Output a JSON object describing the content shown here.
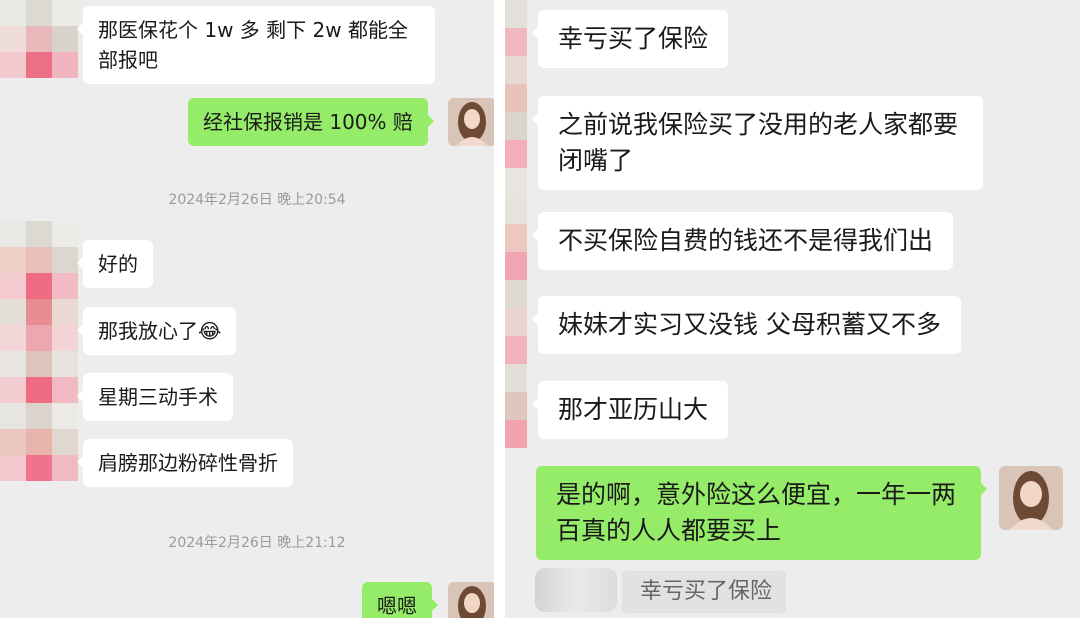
{
  "left": {
    "messages": [
      {
        "text": "那医保花个 1w 多 剩下 2w 都能全部报吧",
        "side": "in"
      },
      {
        "text": "经社保报销是 100% 赔",
        "side": "out"
      },
      {
        "text": "好的",
        "side": "in"
      },
      {
        "text": "那我放心了",
        "emoji": "😂",
        "side": "in"
      },
      {
        "text": "星期三动手术",
        "side": "in"
      },
      {
        "text": "肩膀那边粉碎性骨折",
        "side": "in"
      },
      {
        "text": "嗯嗯",
        "side": "out"
      }
    ],
    "timestamps": [
      "2024年2月26日 晚上20:54",
      "2024年2月26日 晚上21:12"
    ]
  },
  "right": {
    "messages": [
      {
        "text": "幸亏买了保险",
        "side": "in"
      },
      {
        "text": "之前说我保险买了没用的老人家都要闭嘴了",
        "side": "in"
      },
      {
        "text": "不买保险自费的钱还不是得我们出",
        "side": "in"
      },
      {
        "text": "妹妹才实习又没钱 父母积蓄又不多",
        "side": "in"
      },
      {
        "text": "那才亚历山大",
        "side": "in"
      },
      {
        "text": "是的啊，意外险这么便宜，一年一两百真的人人都要买上",
        "side": "out"
      }
    ],
    "quote": "幸亏买了保险"
  },
  "colors": {
    "background": "#ededed",
    "incoming": "#ffffff",
    "outgoing": "#95ec69",
    "timestamp": "#9a9a9a"
  },
  "icons": {
    "avatar": "woman-portrait-avatar",
    "contact": "pixelated-avatar"
  }
}
